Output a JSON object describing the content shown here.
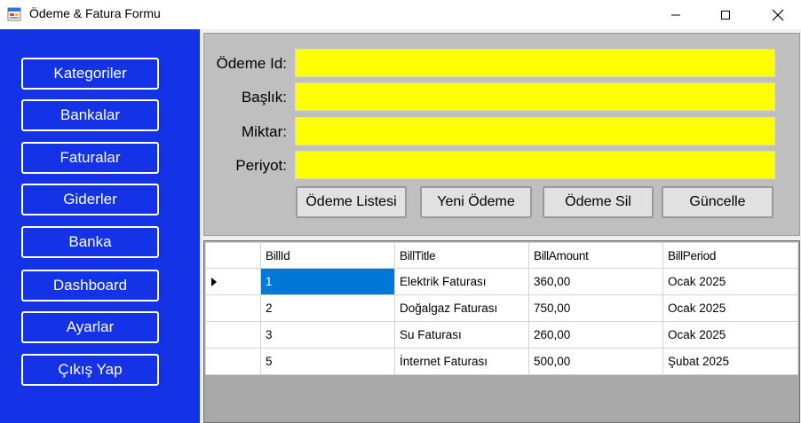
{
  "window": {
    "title": "Ödeme & Fatura Formu",
    "icon": "form-app-icon"
  },
  "sidebar": {
    "items": [
      {
        "label": "Kategoriler"
      },
      {
        "label": "Bankalar"
      },
      {
        "label": "Faturalar"
      },
      {
        "label": "Giderler"
      },
      {
        "label": "Banka"
      },
      {
        "label": "Dashboard"
      },
      {
        "label": "Ayarlar"
      },
      {
        "label": "Çıkış Yap"
      }
    ]
  },
  "form": {
    "fields": [
      {
        "label": "Ödeme Id:",
        "value": ""
      },
      {
        "label": "Başlık:",
        "value": ""
      },
      {
        "label": "Miktar:",
        "value": ""
      },
      {
        "label": "Periyot:",
        "value": ""
      }
    ],
    "buttons": [
      {
        "label": "Ödeme Listesi"
      },
      {
        "label": "Yeni Ödeme"
      },
      {
        "label": "Ödeme Sil"
      },
      {
        "label": "Güncelle"
      }
    ]
  },
  "grid": {
    "columns": [
      "BillId",
      "BillTitle",
      "BillAmount",
      "BillPeriod"
    ],
    "rows": [
      [
        "1",
        "Elektrik Faturası",
        "360,00",
        "Ocak 2025"
      ],
      [
        "2",
        "Doğalgaz Faturası",
        "750,00",
        "Ocak 2025"
      ],
      [
        "3",
        "Su Faturası",
        "260,00",
        "Ocak 2025"
      ],
      [
        "5",
        "İnternet Faturası",
        "500,00",
        "Şubat 2025"
      ]
    ]
  },
  "colors": {
    "sidebar": "#1433e6",
    "input": "#ffff00",
    "selection": "#0078d7"
  }
}
